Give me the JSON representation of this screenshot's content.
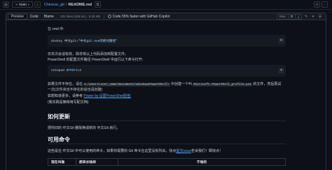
{
  "topbar": {
    "branch": "main",
    "repo": "Chinese_git",
    "separator": "/",
    "file": "README.md"
  },
  "toolbar": {
    "tab_preview": "Preview",
    "tab_code": "Code",
    "tab_blame": "Blame",
    "meta": "131 lines (106 loc) · 5.33 KB",
    "copilot": "Code 55% faster with GitHub Copilot",
    "raw": "Raw"
  },
  "doc": {
    "p_cmd": "在 cmd 中:",
    "code1_prefix": "doskey 中文git=",
    "code1_string": "\"中文git.exe的绝对路径\"",
    "p_ps1": "仅本次会话有效，除非将以上代码添加到配置文件。",
    "p_ps2": "PowerShell 的配置文件路径 PowerShell 中运行以下命令打开:",
    "code2_cmd": "notepad",
    "code2_var": "$PROFILE",
    "p_create_a": "如果文件不存在，请在",
    "p_create_path1": "C:\\Users\\user_name\\Documents\\WindowsPowerShell\\",
    "p_create_b": "中创建一个叫",
    "p_create_file": "Microsoft.PowerShell_profile.ps1",
    "p_create_c": "的文件，然后再试",
    "p_create_2": "一次(文件夹也不存在的话也请创建)",
    "p_more_a": "如想知道更多，请参考",
    "p_more_link": "Power by 设置PowerShell别名",
    "p_alt": "(我实践是懒得用写配文档)",
    "h_update": "如何更新",
    "p_update": "把你旧的 中文Git 删除换成新的 中文Git 就行。",
    "h_commands": "可用命令",
    "p_commands_a": "这些是在 中文Git 中可以使用的命令，如果你需要的 Git 命令在这里没有列出，快点",
    "p_commands_link": "提交issue",
    "p_commands_b": "告诉我们！瞬快点！",
    "table_headers": [
      "现在叫做",
      "原来长啥样",
      "干啥的"
    ]
  }
}
